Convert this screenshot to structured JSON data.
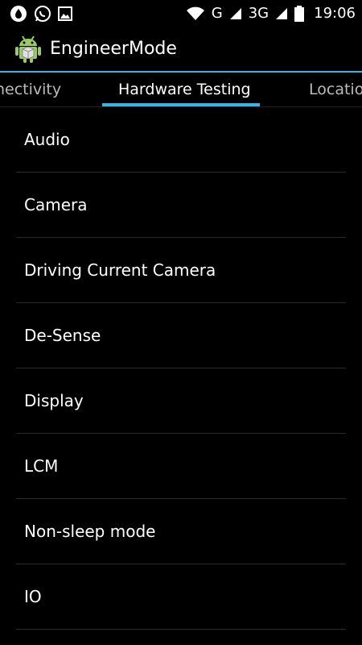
{
  "status_bar": {
    "time": "19:06",
    "network_g": "G",
    "network_3g": "3G",
    "left_icons": [
      "drop-icon",
      "whatsapp-icon",
      "image-icon"
    ],
    "right_icons": [
      "wifi-icon",
      "signal-icon",
      "battery-icon"
    ]
  },
  "app_bar": {
    "title": "EngineerMode",
    "icon": "android-icon"
  },
  "tabs": {
    "items": [
      {
        "label": "nectivity",
        "active": false
      },
      {
        "label": "Hardware Testing",
        "active": true
      },
      {
        "label": "Locatio",
        "active": false
      }
    ]
  },
  "list": {
    "items": [
      {
        "label": "Audio"
      },
      {
        "label": "Camera"
      },
      {
        "label": "Driving Current Camera"
      },
      {
        "label": "De-Sense"
      },
      {
        "label": "Display"
      },
      {
        "label": "LCM"
      },
      {
        "label": "Non-sleep mode"
      },
      {
        "label": "IO"
      }
    ]
  },
  "colors": {
    "accent": "#33b5e5",
    "background": "#000000",
    "divider": "#2a2a2a"
  }
}
